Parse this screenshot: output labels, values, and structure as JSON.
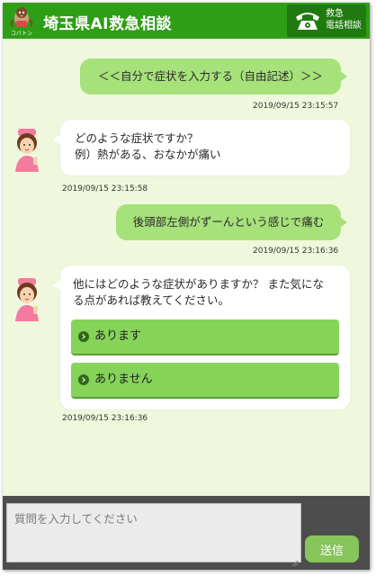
{
  "header": {
    "logo_caption": "コバトン",
    "title": "埼玉県AI救急相談",
    "call_button": {
      "line1": "救急",
      "line2": "電話相談",
      "icon": "telephone-icon"
    }
  },
  "chat": {
    "messages": [
      {
        "sender": "user",
        "text": "＜＜自分で症状を入力する（自由記述）＞＞",
        "timestamp": "2019/09/15 23:15:57"
      },
      {
        "sender": "bot",
        "lines": [
          "どのような症状ですか？",
          "例）熱がある、おなかが痛い"
        ],
        "timestamp": "2019/09/15 23:15:58"
      },
      {
        "sender": "user",
        "text": "後頭部左側がずーんという感じで痛む",
        "timestamp": "2019/09/15 23:16:36"
      },
      {
        "sender": "bot",
        "lines": [
          "他にはどのような症状がありますか？ また気にな",
          "る点があれば教えてください。"
        ],
        "choices": [
          {
            "label": "あります"
          },
          {
            "label": "ありません"
          }
        ],
        "timestamp": "2019/09/15 23:16:36"
      }
    ]
  },
  "footer": {
    "input_placeholder": "質問を入力してください",
    "input_value": "",
    "send_label": "送信"
  },
  "colors": {
    "header_green": "#2f9e17",
    "chat_background": "#eff8dc",
    "user_bubble": "#a7e17a",
    "choice_button": "#86d35a",
    "footer_dark": "#4d4d4d",
    "send_button": "#86c45c"
  }
}
